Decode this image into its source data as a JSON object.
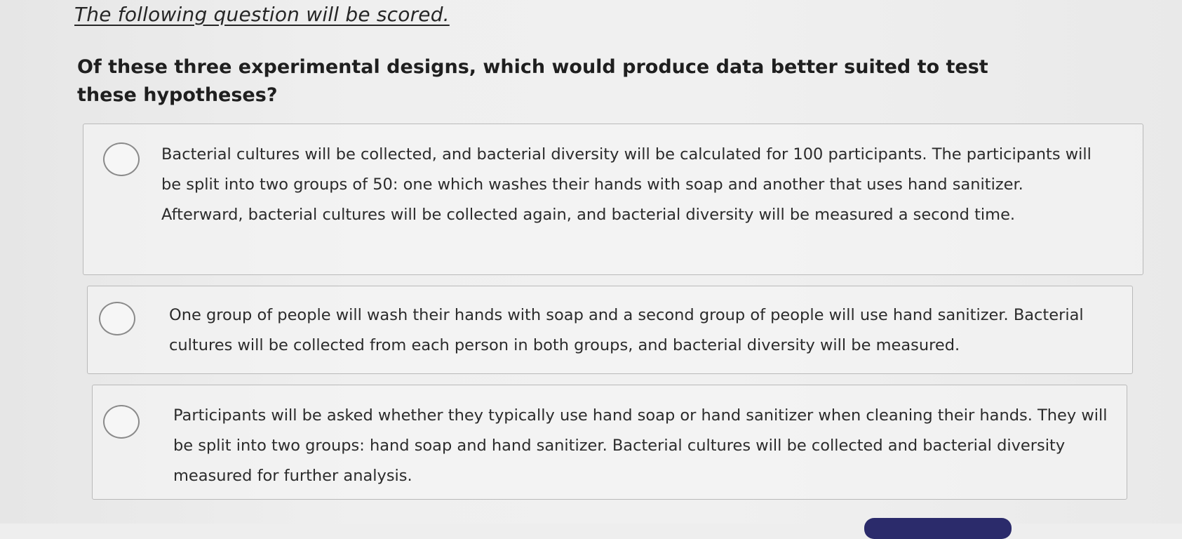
{
  "notice": "The following question will be scored.",
  "question": "Of these three experimental designs, which would produce data better suited to test these hypotheses?",
  "options": [
    {
      "text": "Bacterial cultures will be collected, and bacterial diversity will be calculated for 100 participants. The participants will be split into two groups of 50: one which washes their hands with soap and another that uses hand sanitizer. Afterward, bacterial cultures will be collected again, and bacterial diversity will be measured a second time.",
      "selected": false
    },
    {
      "text": "One group of people will wash their hands with soap and a second group of people will use hand sanitizer. Bacterial cultures will be collected from each person in both groups, and bacterial diversity will be measured.",
      "selected": false
    },
    {
      "text": "Participants will be asked whether they typically use hand soap or hand sanitizer when cleaning their hands. They will be split into two groups: hand soap and hand sanitizer. Bacterial cultures will be collected and bacterial diversity measured for further analysis.",
      "selected": false
    }
  ],
  "colors": {
    "background": "#eeeeee",
    "border": "#b9b9b9",
    "radio_border": "#8a8a8a",
    "button": "#2b2b6b"
  }
}
